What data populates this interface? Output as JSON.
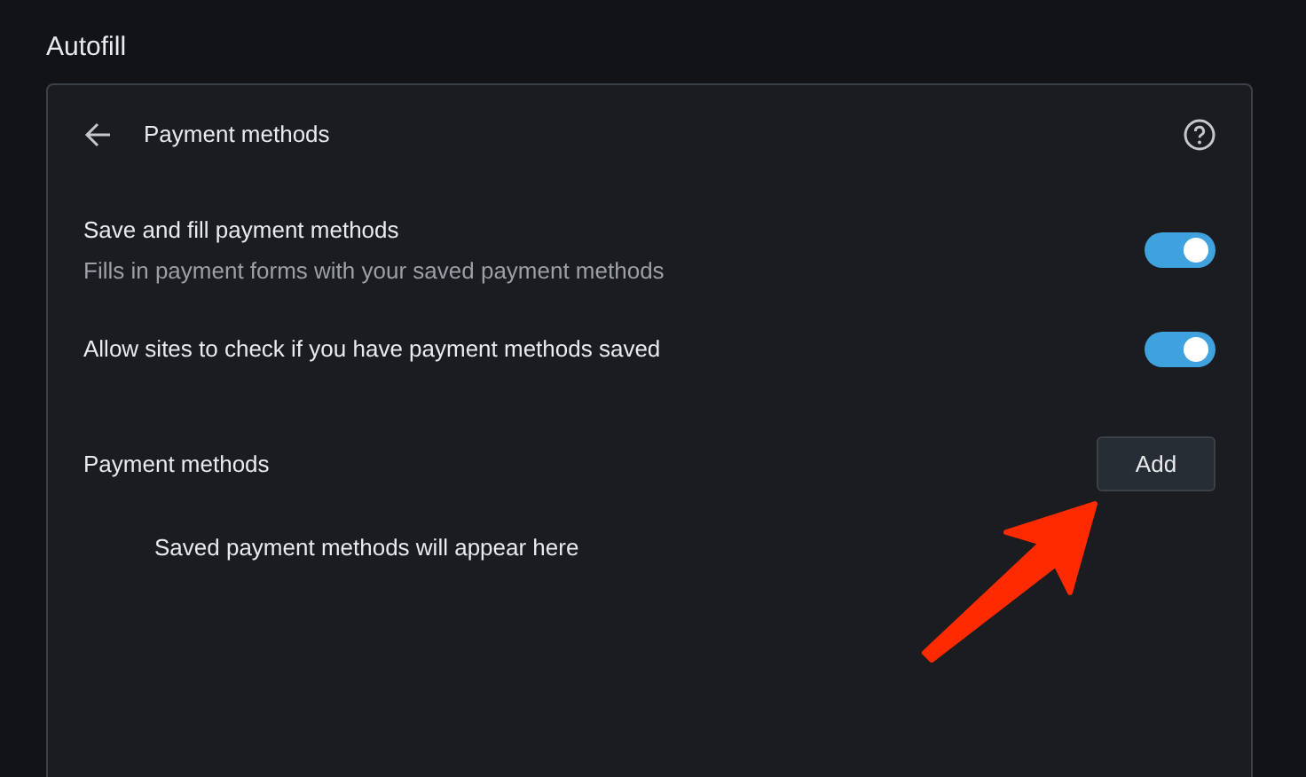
{
  "page_title": "Autofill",
  "panel": {
    "title": "Payment methods",
    "settings": [
      {
        "label": "Save and fill payment methods",
        "description": "Fills in payment forms with your saved payment methods",
        "on": true
      },
      {
        "label": "Allow sites to check if you have payment methods saved",
        "on": true
      }
    ],
    "section": {
      "label": "Payment methods",
      "button": "Add",
      "empty_message": "Saved payment methods will appear here"
    }
  }
}
